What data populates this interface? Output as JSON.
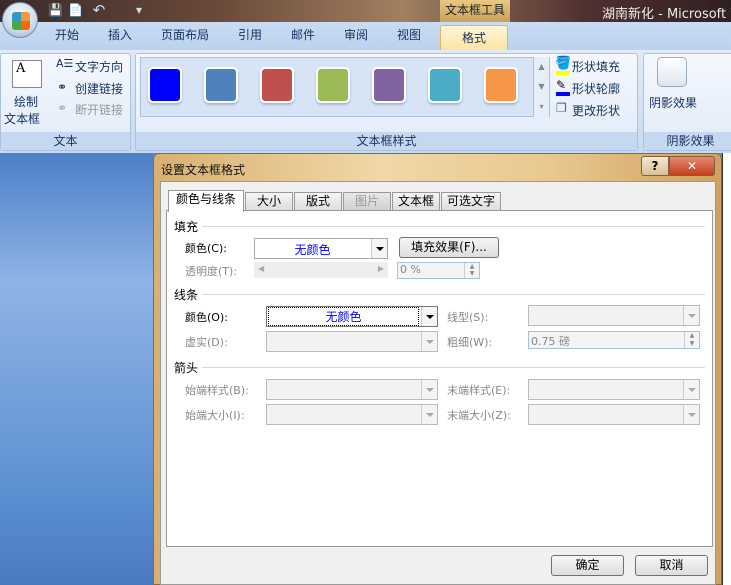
{
  "window": {
    "title": "湖南新化 - Microsoft W",
    "context_tools": "文本框工具"
  },
  "quick_access": {
    "save": "💾",
    "new": "📄",
    "undo": "↶",
    "customize": "▾"
  },
  "ribbon_tabs": [
    "开始",
    "插入",
    "页面布局",
    "引用",
    "邮件",
    "审阅",
    "视图",
    "格式"
  ],
  "ribbon": {
    "text_group": {
      "label": "文本",
      "draw_textbox": "绘制",
      "draw_textbox2": "文本框",
      "text_direction": "文字方向",
      "create_link": "创建链接",
      "break_link": "断开链接"
    },
    "styles_group": {
      "label": "文本框样式",
      "swatches": [
        "#0000ff",
        "#4f81bd",
        "#c0504d",
        "#9bbb59",
        "#8064a2",
        "#4bacc6",
        "#f79646"
      ],
      "shape_fill": "形状填充",
      "shape_outline": "形状轮廓",
      "change_shape": "更改形状"
    },
    "shadow_group": {
      "label": "阴影效果",
      "shadow_effects": "阴影效果"
    }
  },
  "dialog": {
    "title": "设置文本框格式",
    "help": "?",
    "close": "✕",
    "tabs": [
      "颜色与线条",
      "大小",
      "版式",
      "图片",
      "文本框",
      "可选文字"
    ],
    "fill": {
      "heading": "填充",
      "color_label": "颜色(C):",
      "color_value": "无颜色",
      "fill_effects": "填充效果(F)...",
      "transparency_label": "透明度(T):",
      "transparency_value": "0 %"
    },
    "line": {
      "heading": "线条",
      "color_label": "颜色(O):",
      "color_value": "无颜色",
      "style_label": "线型(S):",
      "dash_label": "虚实(D):",
      "weight_label": "粗细(W):",
      "weight_value": "0.75 磅"
    },
    "arrows": {
      "heading": "箭头",
      "begin_style": "始端样式(B):",
      "end_style": "末端样式(E):",
      "begin_size": "始端大小(I):",
      "end_size": "末端大小(Z):"
    },
    "ok": "确定",
    "cancel": "取消"
  }
}
